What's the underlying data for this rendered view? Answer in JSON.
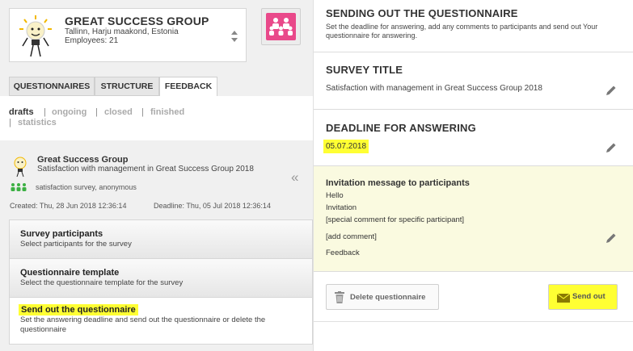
{
  "company": {
    "name": "GREAT SUCCESS GROUP",
    "location": "Tallinn, Harju maakond, Estonia",
    "employees": "Employees: 21"
  },
  "tabs": [
    {
      "label": "QUESTIONNAIRES",
      "active": false
    },
    {
      "label": "STRUCTURE",
      "active": false
    },
    {
      "label": "FEEDBACK",
      "active": true
    }
  ],
  "filters": {
    "drafts": "drafts",
    "ongoing": "ongoing",
    "closed": "closed",
    "finished": "finished",
    "statistics": "statistics",
    "separator": "|"
  },
  "summary": {
    "company": "Great Success Group",
    "title": "Satisfaction with management in Great Success Group 2018",
    "type": "satisfaction survey, anonymous",
    "created": "Created: Thu, 28 Jun 2018 12:36:14",
    "deadline": "Deadline: Thu, 05 Jul 2018 12:36:14",
    "collapse_glyph": "«"
  },
  "steps": [
    {
      "title": "Survey participants",
      "desc": "Select participants for the survey"
    },
    {
      "title": "Questionnaire template",
      "desc": "Select the questionnaire template for the survey"
    },
    {
      "title": "Send out the questionnaire",
      "desc": "Set the answering deadline and send out the questionnaire or delete the questionnaire"
    }
  ],
  "send_section": {
    "heading": "SENDING OUT THE QUESTIONNAIRE",
    "desc": "Set the deadline for answering, add any comments to participants and send out Your questionnaire for answering."
  },
  "survey_title_section": {
    "heading": "SURVEY TITLE",
    "value": "Satisfaction with management in Great Success Group 2018"
  },
  "deadline_section": {
    "heading": "DEADLINE FOR ANSWERING",
    "value": "05.07.2018"
  },
  "invitation": {
    "heading": "Invitation message to participants",
    "lines": [
      "Hello",
      "Invitation",
      "[special comment for specific participant]",
      "[add comment]",
      "Feedback"
    ]
  },
  "buttons": {
    "delete": "Delete questionnaire",
    "send": "Send out"
  },
  "colors": {
    "highlight": "#ffff33",
    "group_button": "#e9498a",
    "invitation_bg": "#fafae0",
    "panel_bg": "#f0f0f0"
  }
}
